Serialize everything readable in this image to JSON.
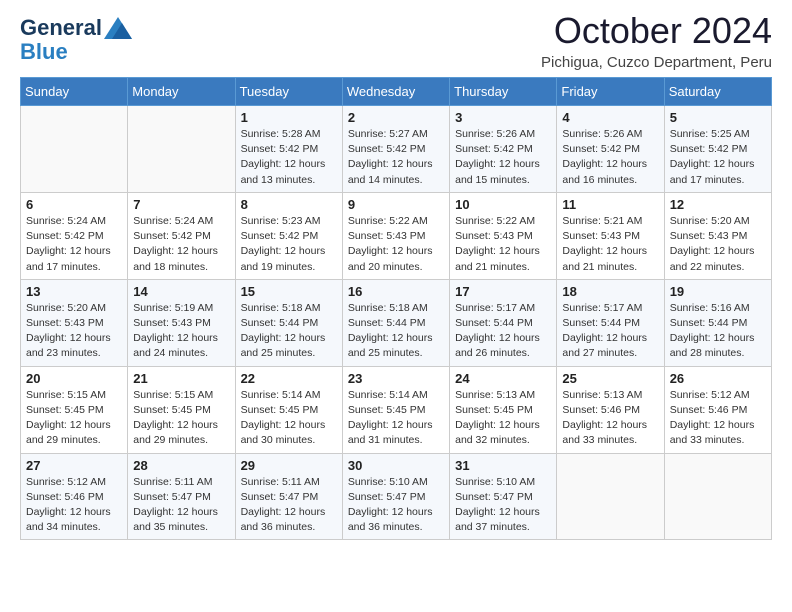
{
  "header": {
    "logo_line1": "General",
    "logo_line2": "Blue",
    "month_year": "October 2024",
    "location": "Pichigua, Cuzco Department, Peru"
  },
  "days_of_week": [
    "Sunday",
    "Monday",
    "Tuesday",
    "Wednesday",
    "Thursday",
    "Friday",
    "Saturday"
  ],
  "weeks": [
    [
      {
        "day": "",
        "sunrise": "",
        "sunset": "",
        "daylight": ""
      },
      {
        "day": "",
        "sunrise": "",
        "sunset": "",
        "daylight": ""
      },
      {
        "day": "1",
        "sunrise": "Sunrise: 5:28 AM",
        "sunset": "Sunset: 5:42 PM",
        "daylight": "Daylight: 12 hours and 13 minutes."
      },
      {
        "day": "2",
        "sunrise": "Sunrise: 5:27 AM",
        "sunset": "Sunset: 5:42 PM",
        "daylight": "Daylight: 12 hours and 14 minutes."
      },
      {
        "day": "3",
        "sunrise": "Sunrise: 5:26 AM",
        "sunset": "Sunset: 5:42 PM",
        "daylight": "Daylight: 12 hours and 15 minutes."
      },
      {
        "day": "4",
        "sunrise": "Sunrise: 5:26 AM",
        "sunset": "Sunset: 5:42 PM",
        "daylight": "Daylight: 12 hours and 16 minutes."
      },
      {
        "day": "5",
        "sunrise": "Sunrise: 5:25 AM",
        "sunset": "Sunset: 5:42 PM",
        "daylight": "Daylight: 12 hours and 17 minutes."
      }
    ],
    [
      {
        "day": "6",
        "sunrise": "Sunrise: 5:24 AM",
        "sunset": "Sunset: 5:42 PM",
        "daylight": "Daylight: 12 hours and 17 minutes."
      },
      {
        "day": "7",
        "sunrise": "Sunrise: 5:24 AM",
        "sunset": "Sunset: 5:42 PM",
        "daylight": "Daylight: 12 hours and 18 minutes."
      },
      {
        "day": "8",
        "sunrise": "Sunrise: 5:23 AM",
        "sunset": "Sunset: 5:42 PM",
        "daylight": "Daylight: 12 hours and 19 minutes."
      },
      {
        "day": "9",
        "sunrise": "Sunrise: 5:22 AM",
        "sunset": "Sunset: 5:43 PM",
        "daylight": "Daylight: 12 hours and 20 minutes."
      },
      {
        "day": "10",
        "sunrise": "Sunrise: 5:22 AM",
        "sunset": "Sunset: 5:43 PM",
        "daylight": "Daylight: 12 hours and 21 minutes."
      },
      {
        "day": "11",
        "sunrise": "Sunrise: 5:21 AM",
        "sunset": "Sunset: 5:43 PM",
        "daylight": "Daylight: 12 hours and 21 minutes."
      },
      {
        "day": "12",
        "sunrise": "Sunrise: 5:20 AM",
        "sunset": "Sunset: 5:43 PM",
        "daylight": "Daylight: 12 hours and 22 minutes."
      }
    ],
    [
      {
        "day": "13",
        "sunrise": "Sunrise: 5:20 AM",
        "sunset": "Sunset: 5:43 PM",
        "daylight": "Daylight: 12 hours and 23 minutes."
      },
      {
        "day": "14",
        "sunrise": "Sunrise: 5:19 AM",
        "sunset": "Sunset: 5:43 PM",
        "daylight": "Daylight: 12 hours and 24 minutes."
      },
      {
        "day": "15",
        "sunrise": "Sunrise: 5:18 AM",
        "sunset": "Sunset: 5:44 PM",
        "daylight": "Daylight: 12 hours and 25 minutes."
      },
      {
        "day": "16",
        "sunrise": "Sunrise: 5:18 AM",
        "sunset": "Sunset: 5:44 PM",
        "daylight": "Daylight: 12 hours and 25 minutes."
      },
      {
        "day": "17",
        "sunrise": "Sunrise: 5:17 AM",
        "sunset": "Sunset: 5:44 PM",
        "daylight": "Daylight: 12 hours and 26 minutes."
      },
      {
        "day": "18",
        "sunrise": "Sunrise: 5:17 AM",
        "sunset": "Sunset: 5:44 PM",
        "daylight": "Daylight: 12 hours and 27 minutes."
      },
      {
        "day": "19",
        "sunrise": "Sunrise: 5:16 AM",
        "sunset": "Sunset: 5:44 PM",
        "daylight": "Daylight: 12 hours and 28 minutes."
      }
    ],
    [
      {
        "day": "20",
        "sunrise": "Sunrise: 5:15 AM",
        "sunset": "Sunset: 5:45 PM",
        "daylight": "Daylight: 12 hours and 29 minutes."
      },
      {
        "day": "21",
        "sunrise": "Sunrise: 5:15 AM",
        "sunset": "Sunset: 5:45 PM",
        "daylight": "Daylight: 12 hours and 29 minutes."
      },
      {
        "day": "22",
        "sunrise": "Sunrise: 5:14 AM",
        "sunset": "Sunset: 5:45 PM",
        "daylight": "Daylight: 12 hours and 30 minutes."
      },
      {
        "day": "23",
        "sunrise": "Sunrise: 5:14 AM",
        "sunset": "Sunset: 5:45 PM",
        "daylight": "Daylight: 12 hours and 31 minutes."
      },
      {
        "day": "24",
        "sunrise": "Sunrise: 5:13 AM",
        "sunset": "Sunset: 5:45 PM",
        "daylight": "Daylight: 12 hours and 32 minutes."
      },
      {
        "day": "25",
        "sunrise": "Sunrise: 5:13 AM",
        "sunset": "Sunset: 5:46 PM",
        "daylight": "Daylight: 12 hours and 33 minutes."
      },
      {
        "day": "26",
        "sunrise": "Sunrise: 5:12 AM",
        "sunset": "Sunset: 5:46 PM",
        "daylight": "Daylight: 12 hours and 33 minutes."
      }
    ],
    [
      {
        "day": "27",
        "sunrise": "Sunrise: 5:12 AM",
        "sunset": "Sunset: 5:46 PM",
        "daylight": "Daylight: 12 hours and 34 minutes."
      },
      {
        "day": "28",
        "sunrise": "Sunrise: 5:11 AM",
        "sunset": "Sunset: 5:47 PM",
        "daylight": "Daylight: 12 hours and 35 minutes."
      },
      {
        "day": "29",
        "sunrise": "Sunrise: 5:11 AM",
        "sunset": "Sunset: 5:47 PM",
        "daylight": "Daylight: 12 hours and 36 minutes."
      },
      {
        "day": "30",
        "sunrise": "Sunrise: 5:10 AM",
        "sunset": "Sunset: 5:47 PM",
        "daylight": "Daylight: 12 hours and 36 minutes."
      },
      {
        "day": "31",
        "sunrise": "Sunrise: 5:10 AM",
        "sunset": "Sunset: 5:47 PM",
        "daylight": "Daylight: 12 hours and 37 minutes."
      },
      {
        "day": "",
        "sunrise": "",
        "sunset": "",
        "daylight": ""
      },
      {
        "day": "",
        "sunrise": "",
        "sunset": "",
        "daylight": ""
      }
    ]
  ]
}
